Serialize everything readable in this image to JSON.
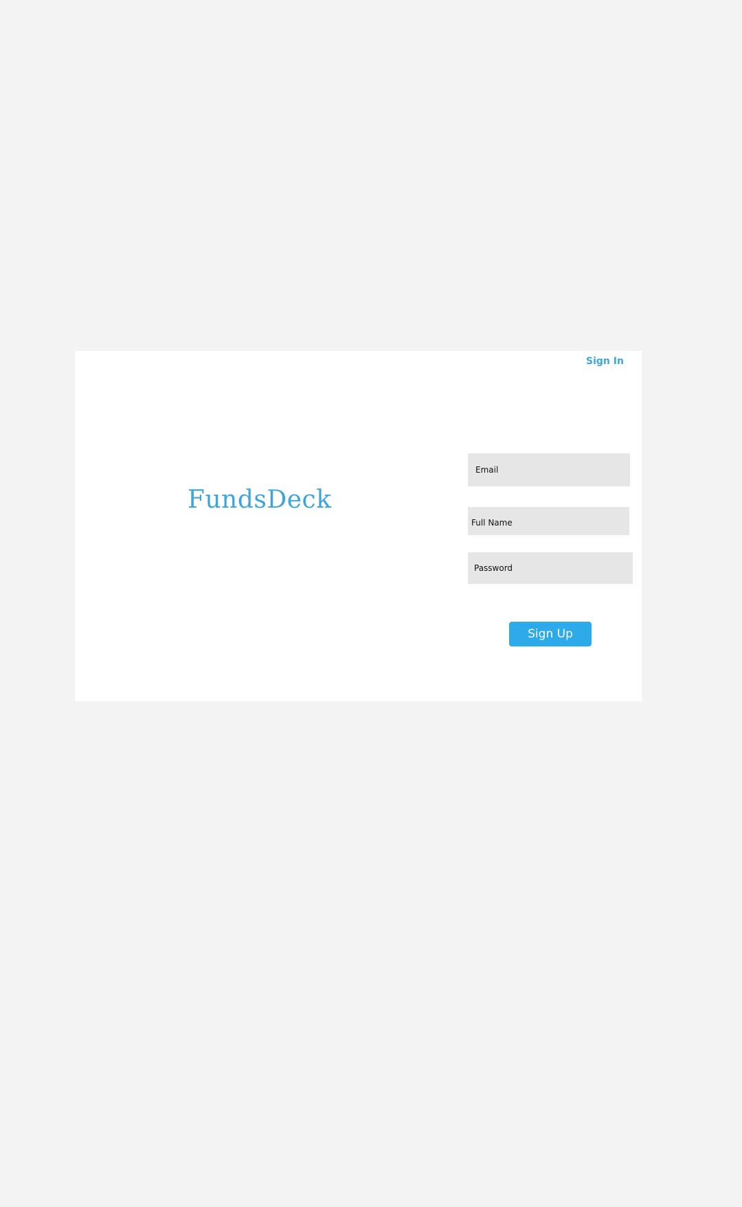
{
  "header": {
    "signin_label": "Sign In"
  },
  "brand": {
    "name": "FundsDeck"
  },
  "form": {
    "email_placeholder": "Email",
    "fullname_placeholder": "Full Name",
    "password_placeholder": "Password",
    "submit_label": "Sign Up"
  },
  "colors": {
    "accent": "#3da6d9",
    "button": "#2daae9",
    "field_bg": "#e6e6e6",
    "page_bg": "#f2f3f2"
  }
}
